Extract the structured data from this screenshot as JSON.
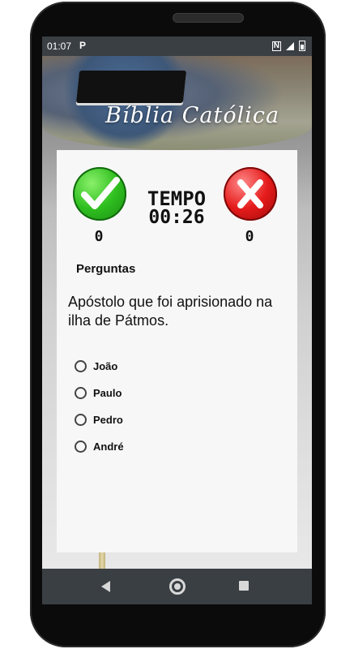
{
  "status_bar": {
    "time": "01:07",
    "app_indicator": "P",
    "nfc": "N"
  },
  "header": {
    "title": "Bíblia Católica"
  },
  "scoreboard": {
    "timer_label": "TEMPO",
    "timer_value": "00:26",
    "correct_count": "0",
    "wrong_count": "0",
    "colors": {
      "correct": "#2fbf1f",
      "wrong": "#e51b1b"
    }
  },
  "quiz": {
    "section_title": "Perguntas",
    "question": "Apóstolo que foi aprisionado na ilha de Pátmos.",
    "options": [
      {
        "label": "João"
      },
      {
        "label": "Paulo"
      },
      {
        "label": "Pedro"
      },
      {
        "label": "André"
      }
    ]
  },
  "icons": {
    "correct": "check-icon",
    "wrong": "x-icon",
    "nav_back": "back-triangle-icon",
    "nav_home": "home-circle-icon",
    "nav_recent": "recent-square-icon"
  }
}
